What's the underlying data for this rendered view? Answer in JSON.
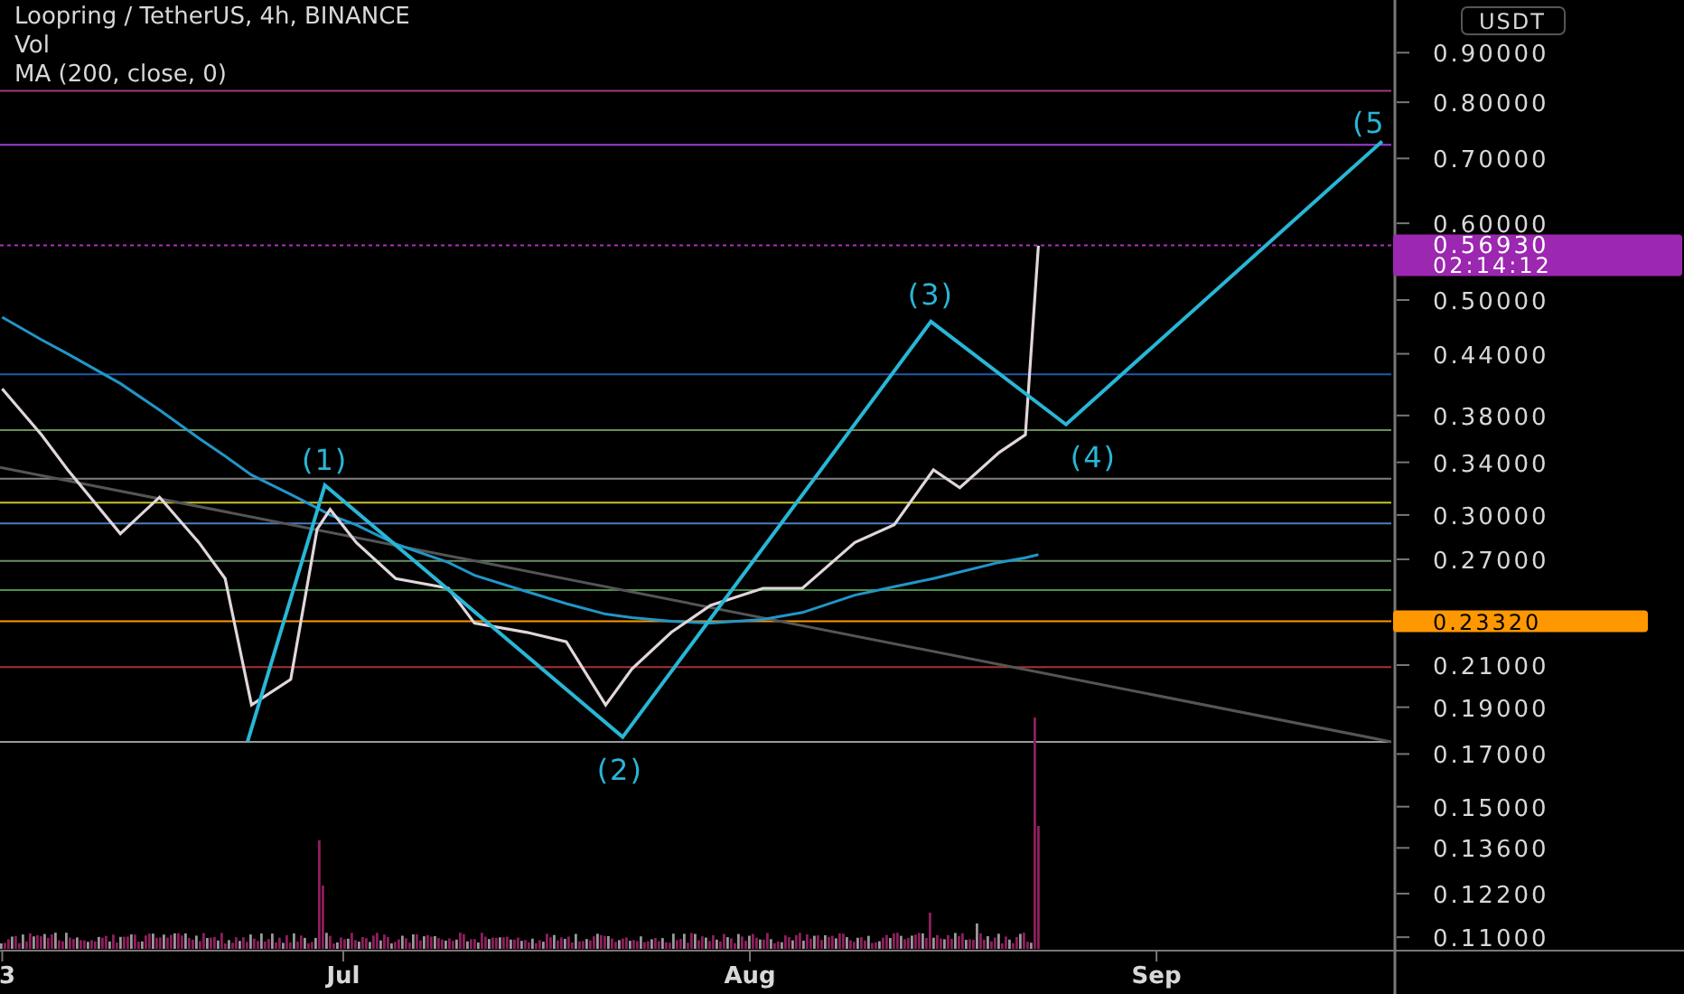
{
  "legend": {
    "title": "Loopring / TetherUS, 4h, BINANCE",
    "volume": "Vol",
    "indicator": "MA (200, close, 0)"
  },
  "currency_badge": "USDT",
  "price_badge": {
    "price": "0.56930",
    "countdown": "02:14:12"
  },
  "level_badge": {
    "price": "0.23320"
  },
  "wave_labels": [
    "(1)",
    "(2)",
    "(3)",
    "(4)",
    "(5"
  ],
  "price_axis": [
    "0.90000",
    "0.80000",
    "0.70000",
    "0.60000",
    "0.50000",
    "0.44000",
    "0.38000",
    "0.34000",
    "0.30000",
    "0.27000",
    "0.21000",
    "0.19000",
    "0.17000",
    "0.15000",
    "0.13600",
    "0.12200",
    "0.11000"
  ],
  "time_axis": [
    "3",
    "Jul",
    "Aug",
    "Sep"
  ]
}
